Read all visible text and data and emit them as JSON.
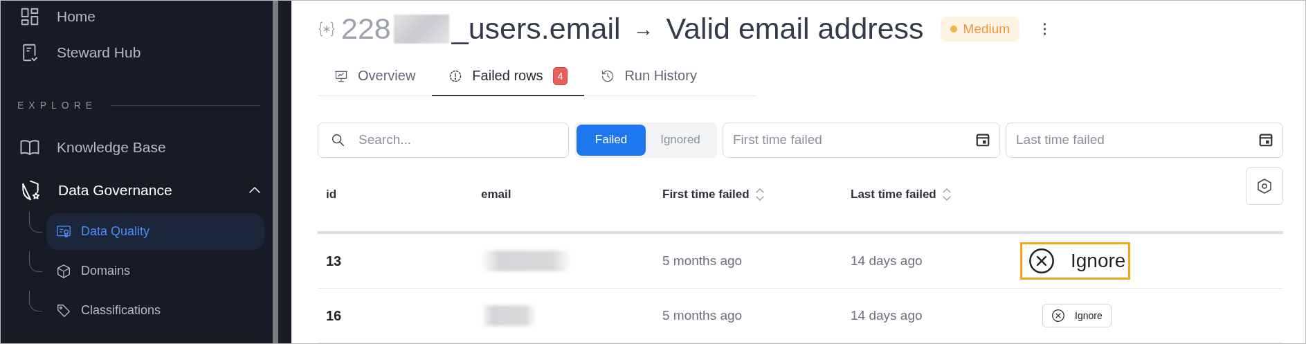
{
  "sidebar": {
    "top_items": [
      {
        "label": "Home"
      },
      {
        "label": "Steward Hub"
      }
    ],
    "section_label": "EXPLORE",
    "items": [
      {
        "label": "Knowledge Base",
        "expanded": false
      },
      {
        "label": "Data Governance",
        "expanded": true,
        "children": [
          {
            "label": "Data Quality",
            "selected": true
          },
          {
            "label": "Domains",
            "selected": false
          },
          {
            "label": "Classifications",
            "selected": false
          }
        ]
      }
    ]
  },
  "header": {
    "title_number": "228",
    "title_name": "_users.email",
    "arrow": "→",
    "rule_name": "Valid email address",
    "severity": {
      "label": "Medium",
      "color": "#f5b642"
    }
  },
  "tabs": [
    {
      "label": "Overview",
      "selected": false
    },
    {
      "label": "Failed rows",
      "selected": true,
      "badge": "4"
    },
    {
      "label": "Run History",
      "selected": false
    }
  ],
  "filters": {
    "search": {
      "placeholder": "Search..."
    },
    "status_toggle": [
      {
        "label": "Failed",
        "selected": true
      },
      {
        "label": "Ignored",
        "selected": false
      }
    ],
    "date_fields": [
      {
        "placeholder": "First time failed"
      },
      {
        "placeholder": "Last time failed"
      }
    ]
  },
  "table": {
    "columns": [
      {
        "label": "id",
        "sortable": false
      },
      {
        "label": "email",
        "sortable": false
      },
      {
        "label": "First time failed",
        "sortable": true
      },
      {
        "label": "Last time failed",
        "sortable": true
      }
    ],
    "rows": [
      {
        "id": "13",
        "first_failed": "5 months ago",
        "last_failed": "14 days ago",
        "action": "Ignore",
        "highlighted": true
      },
      {
        "id": "16",
        "first_failed": "5 months ago",
        "last_failed": "14 days ago",
        "action": "Ignore",
        "highlighted": false
      }
    ]
  }
}
